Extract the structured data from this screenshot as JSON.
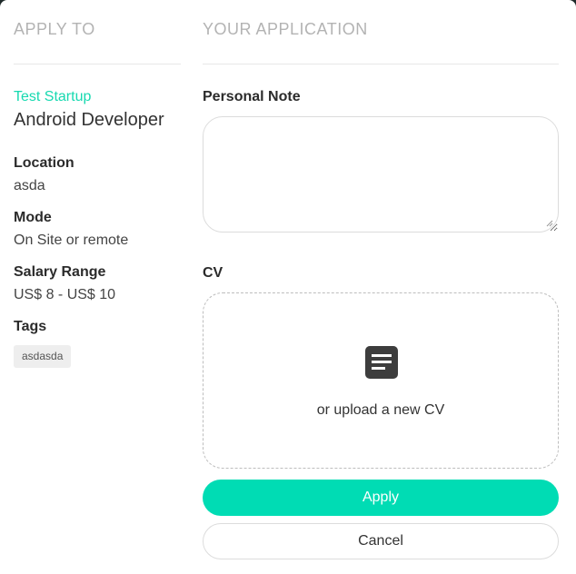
{
  "left": {
    "heading": "APPLY TO",
    "company": "Test Startup",
    "job_title": "Android Developer",
    "fields": [
      {
        "label": "Location",
        "value": "asda"
      },
      {
        "label": "Mode",
        "value": "On Site or remote"
      },
      {
        "label": "Salary Range",
        "value": "US$ 8 - US$ 10"
      }
    ],
    "tags_label": "Tags",
    "tags": [
      "asdasda"
    ]
  },
  "right": {
    "heading": "YOUR APPLICATION",
    "note_label": "Personal Note",
    "note_value": "",
    "cv_label": "CV",
    "cv_icon": "document-icon",
    "upload_text": "or upload a new CV",
    "apply_label": "Apply",
    "cancel_label": "Cancel"
  },
  "colors": {
    "accent": "#00dcb4",
    "company_text": "#17d9b0",
    "heading_text": "#b3b3b3"
  }
}
